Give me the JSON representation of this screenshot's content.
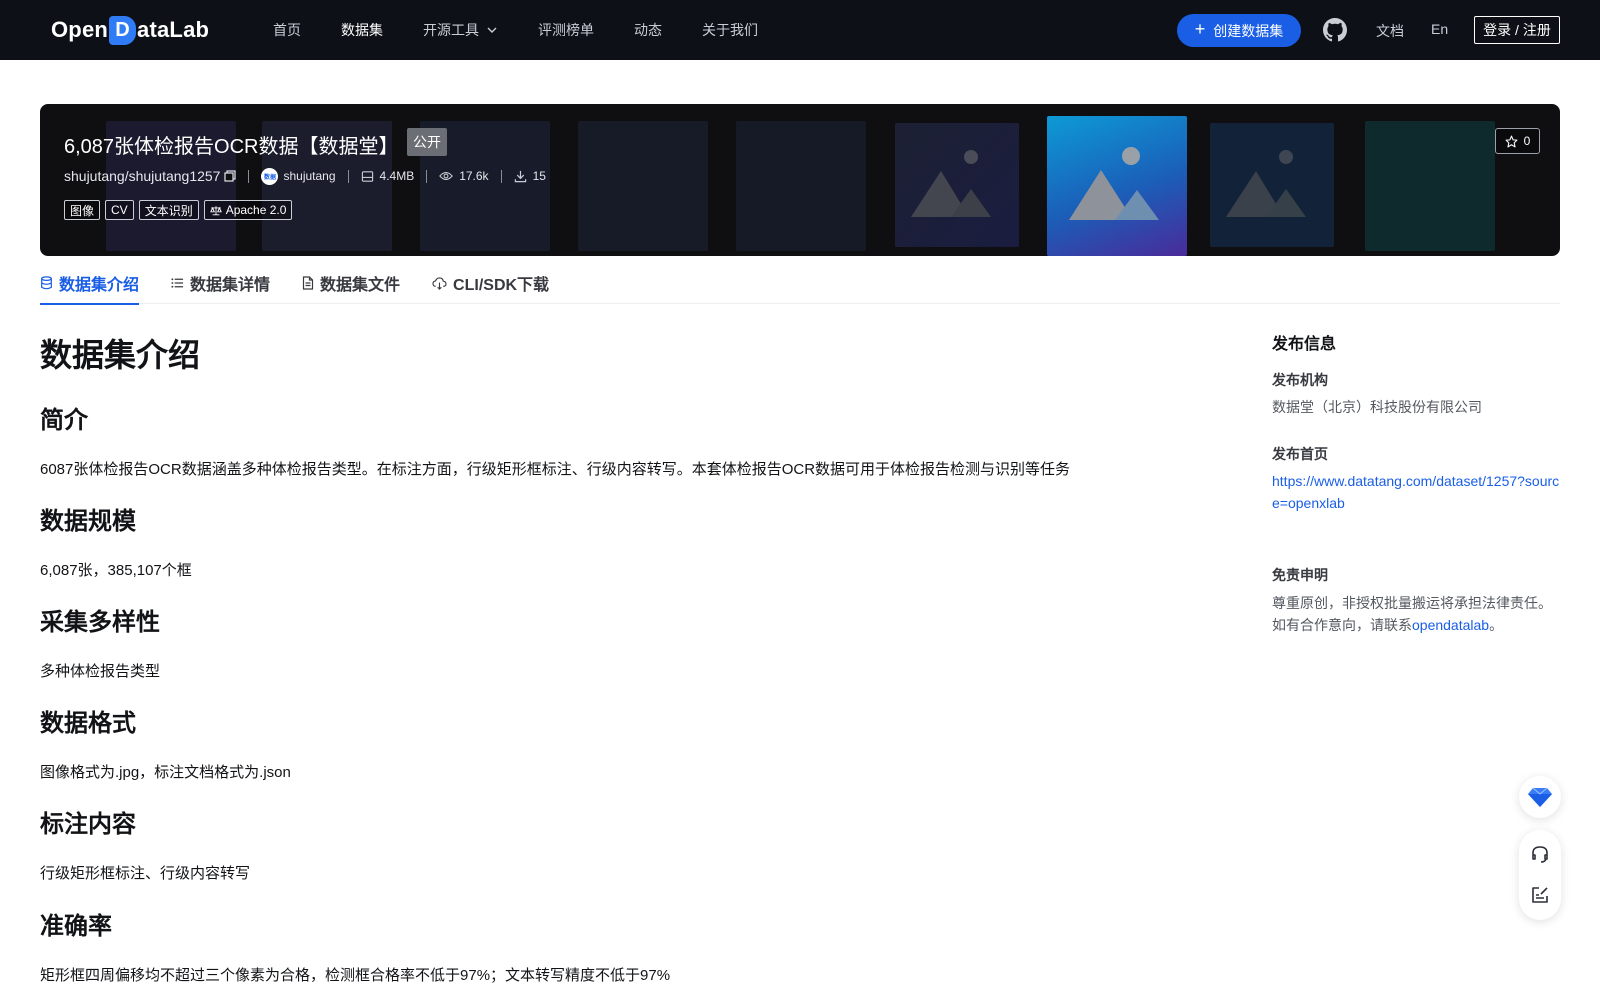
{
  "nav": {
    "logo_left": "Open",
    "logo_d": "D",
    "logo_right": "ataLab",
    "items": [
      {
        "label": "首页",
        "active": false
      },
      {
        "label": "数据集",
        "active": true
      },
      {
        "label": "开源工具",
        "active": false,
        "dropdown": true
      },
      {
        "label": "评测榜单",
        "active": false
      },
      {
        "label": "动态",
        "active": false
      },
      {
        "label": "关于我们",
        "active": false
      }
    ],
    "create_label": "创建数据集",
    "docs": "文档",
    "lang": "En",
    "login": "登录 / 注册"
  },
  "banner": {
    "title": "6,087张体检报告OCR数据【数据堂】",
    "visibility": "公开",
    "star_count": "0",
    "repo": "shujutang/shujutang1257",
    "avatar_text": "数据",
    "owner": "shujutang",
    "size": "4.4MB",
    "views": "17.6k",
    "downloads": "15",
    "tags": [
      "图像",
      "CV",
      "文本识别"
    ],
    "license": "Apache 2.0"
  },
  "tabs": [
    {
      "label": "数据集介绍",
      "icon": "database-icon",
      "active": true
    },
    {
      "label": "数据集详情",
      "icon": "list-icon",
      "active": false
    },
    {
      "label": "数据集文件",
      "icon": "file-icon",
      "active": false
    },
    {
      "label": "CLI/SDK下载",
      "icon": "cloud-download-icon",
      "active": false
    }
  ],
  "content": {
    "title": "数据集介绍",
    "sections": [
      {
        "heading": "简介",
        "text": "6087张体检报告OCR数据涵盖多种体检报告类型。在标注方面，行级矩形框标注、行级内容转写。本套体检报告OCR数据可用于体检报告检测与识别等任务"
      },
      {
        "heading": "数据规模",
        "text": "6,087张，385,107个框"
      },
      {
        "heading": "采集多样性",
        "text": "多种体检报告类型"
      },
      {
        "heading": "数据格式",
        "text": "图像格式为.jpg，标注文档格式为.json"
      },
      {
        "heading": "标注内容",
        "text": "行级矩形框标注、行级内容转写"
      },
      {
        "heading": "准确率",
        "text": "矩形框四周偏移均不超过三个像素为合格，检测框合格率不低于97%；文本转写精度不低于97%"
      }
    ]
  },
  "sidebar": {
    "title": "发布信息",
    "org_label": "发布机构",
    "org": "数据堂（北京）科技股份有限公司",
    "home_label": "发布首页",
    "home_url": "https://www.datatang.com/dataset/1257?source=openxlab",
    "disclaimer_label": "免责申明",
    "disclaimer_1": "尊重原创，非授权批量搬运将承担法律责任。",
    "disclaimer_2_pre": "如有合作意向，请联系",
    "disclaimer_link": "opendatalab",
    "disclaimer_2_post": "。"
  },
  "colors": {
    "accent": "#1a5ee6",
    "nav_bg": "#0d1017",
    "banner_bg": "#0f0f12"
  }
}
